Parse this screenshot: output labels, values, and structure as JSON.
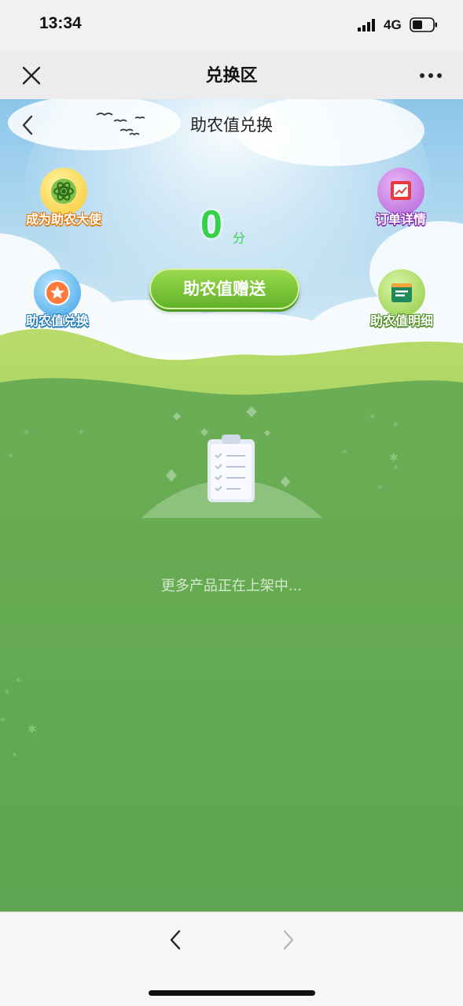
{
  "status_bar": {
    "time": "13:34",
    "network": "4G"
  },
  "nav_bar": {
    "title": "兑换区"
  },
  "header": {
    "title": "助农值兑换"
  },
  "features": {
    "ambassador": "成为助农大使",
    "order_details": "订单详情",
    "exchange": "助农值兑换",
    "value_details": "助农值明细"
  },
  "score": {
    "value": "0",
    "unit": "分"
  },
  "gift_button": {
    "label": "助农值赠送"
  },
  "empty_state": {
    "text": "更多产品正在上架中..."
  },
  "colors": {
    "score_green": "#36d04a",
    "grass_green": "#5ea651",
    "button_green": "#62b42a"
  },
  "icons": {
    "close": "close-icon",
    "more": "more-dots-icon",
    "back": "chevron-left-icon",
    "ambassador": "atom-icon",
    "order_details": "chart-board-icon",
    "exchange": "star-medal-icon",
    "value_details": "list-card-icon",
    "empty": "clipboard-checklist-icon"
  }
}
